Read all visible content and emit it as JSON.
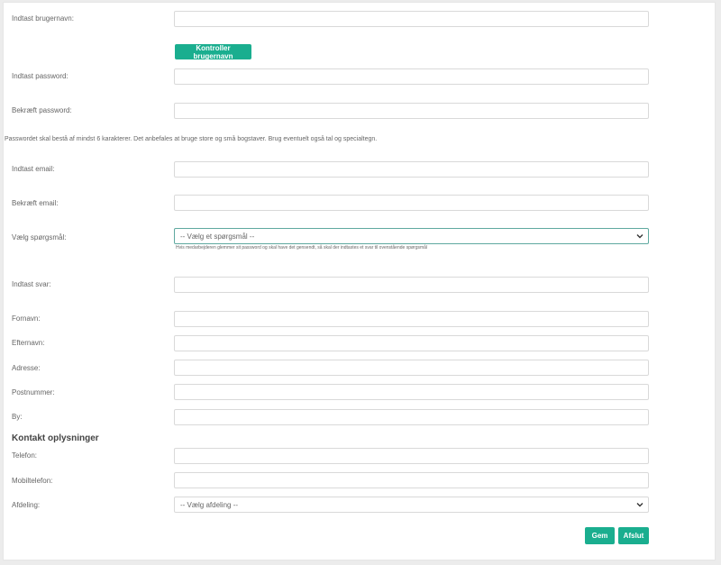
{
  "form": {
    "username_label": "Indtast brugernavn:",
    "check_username_button": "Kontroller brugernavn",
    "password_label": "Indtast password:",
    "confirm_password_label": "Bekræft password:",
    "password_hint": "Passwordet skal bestå af mindst 6 karakterer. Det anbefales at bruge store og små bogstaver. Brug eventuelt også tal og specialtegn.",
    "email_label": "Indtast email:",
    "confirm_email_label": "Bekræft email:",
    "question_label": "Vælg spørgsmål:",
    "question_selected": "-- Vælg et spørgsmål --",
    "question_hint": "Hvis medarbejderen glemmer sit password og skal have det gensendt, så skal der indtastes et svar til ovenstående spørgsmål",
    "answer_label": "Indtast svar:",
    "firstname_label": "Fornavn:",
    "lastname_label": "Efternavn:",
    "address_label": "Adresse:",
    "postal_label": "Postnummer:",
    "city_label": "By:",
    "contact_section_title": "Kontakt oplysninger",
    "phone_label": "Telefon:",
    "mobile_label": "Mobiltelefon:",
    "department_label": "Afdeling:",
    "department_selected": "-- Vælg afdeling --",
    "save_button": "Gem",
    "close_button": "Afslut"
  },
  "colors": {
    "accent": "#1aae8f",
    "background": "#ececec"
  }
}
